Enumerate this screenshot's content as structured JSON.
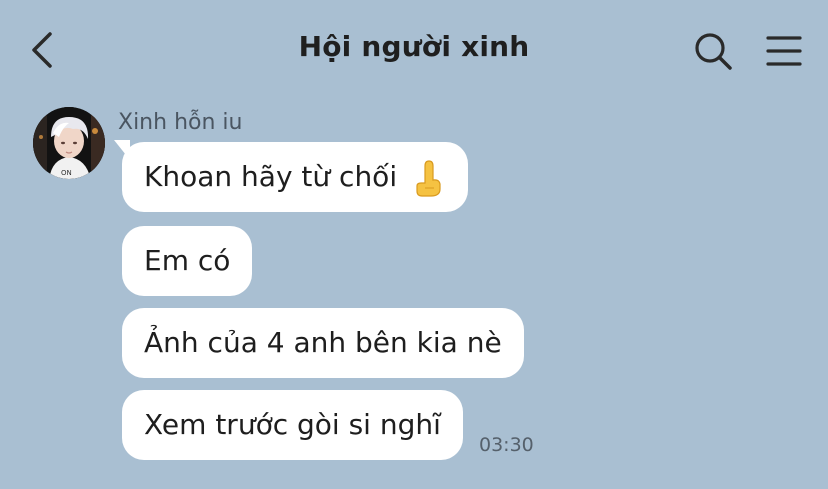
{
  "header": {
    "title": "Hội người xinh"
  },
  "sender": {
    "name": "Xinh hỗn iu"
  },
  "messages": [
    {
      "text": "Khoan hãy từ chối",
      "emoji": "finger-pointing-up-emoji"
    },
    {
      "text": "Em có"
    },
    {
      "text": "Ảnh của 4 anh bên kia nè"
    },
    {
      "text": "Xem trước gòi si nghĩ",
      "time": "03:30"
    }
  ],
  "icons": {
    "back": "chevron-left-icon",
    "search": "search-icon",
    "menu": "hamburger-menu-icon"
  },
  "colors": {
    "background": "#a9bfd2",
    "bubble": "#ffffff",
    "text": "#1e1e1e"
  }
}
